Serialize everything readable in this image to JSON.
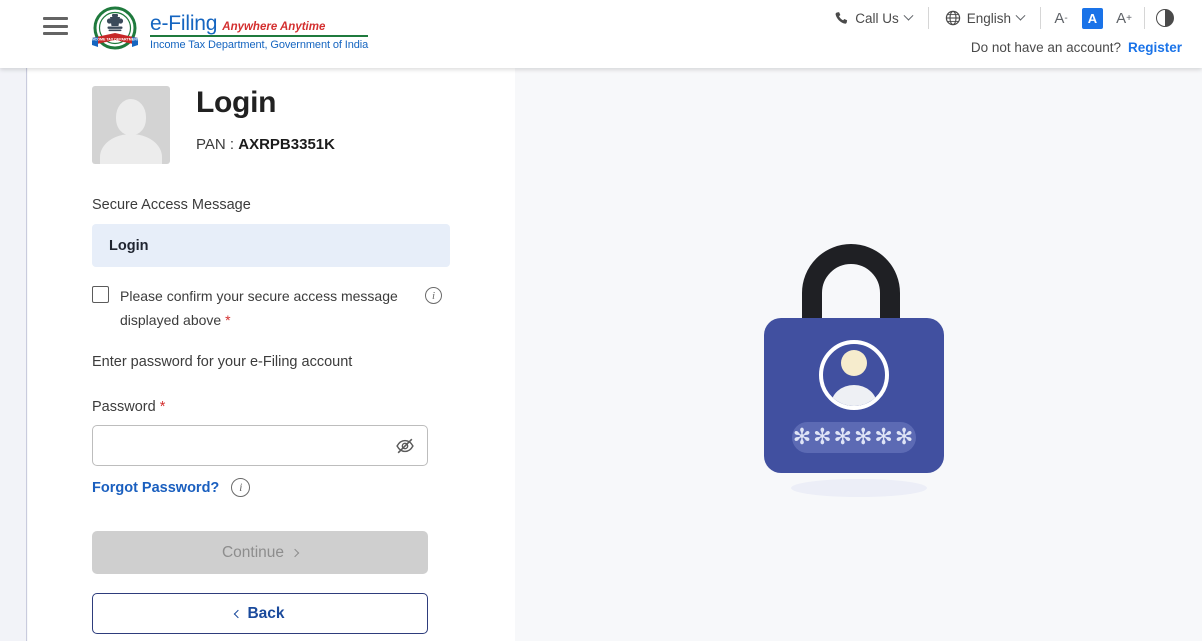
{
  "header": {
    "menu_icon": "hamburger-menu-icon",
    "brand": {
      "emblem_icon": "india-government-emblem-icon",
      "name": "e-Filing",
      "tagline": "Anywhere Anytime",
      "department": "Income Tax Department, Government of India"
    },
    "call_us": {
      "icon": "phone-icon",
      "label": "Call Us"
    },
    "language": {
      "icon": "globe-icon",
      "label": "English"
    },
    "font_size": {
      "decrease": "A",
      "decrease_sup": "-",
      "normal": "A",
      "increase": "A",
      "increase_sup": "+",
      "active": "normal"
    },
    "contrast": {
      "icon": "contrast-icon"
    },
    "account_prompt": "Do not have an account?",
    "register_label": "Register"
  },
  "login": {
    "avatar_icon": "user-avatar-placeholder-icon",
    "title": "Login",
    "pan_label": "PAN :",
    "pan_value": "AXRPB3351K",
    "secure_access_label": "Secure Access Message",
    "secure_access_value": "Login",
    "confirm_text": "Please confirm your secure access message displayed above",
    "required_mark": "*",
    "confirm_info_icon": "info-icon",
    "password_intro": "Enter password for your e-Filing account",
    "password_label": "Password",
    "password_value": "",
    "password_placeholder": "",
    "password_toggle_icon": "eye-slash-icon",
    "forgot_password_label": "Forgot Password?",
    "forgot_info_icon": "info-icon",
    "continue_label": "Continue",
    "continue_chevron_icon": "chevron-right-icon",
    "continue_disabled": true,
    "back_label": "Back",
    "back_chevron_icon": "chevron-left-icon"
  },
  "illustration": {
    "name": "padlock-password-illustration",
    "mask_chars": "✻✻✻✻✻✻",
    "lock_body_color": "#4150a0",
    "shackle_color": "#1f2024",
    "field_color": "#5c6ab4"
  },
  "colors": {
    "accent_blue": "#1a73e8",
    "link_blue": "#1a5fbf",
    "brand_blue": "#1565c0",
    "brand_red": "#d32f2f",
    "brand_green": "#1f7a3d",
    "secure_box_bg": "#e7eef9",
    "page_bg": "#f7f8fa",
    "disabled_btn": "#cfcfcf",
    "navy_border": "#2e3d7c"
  }
}
